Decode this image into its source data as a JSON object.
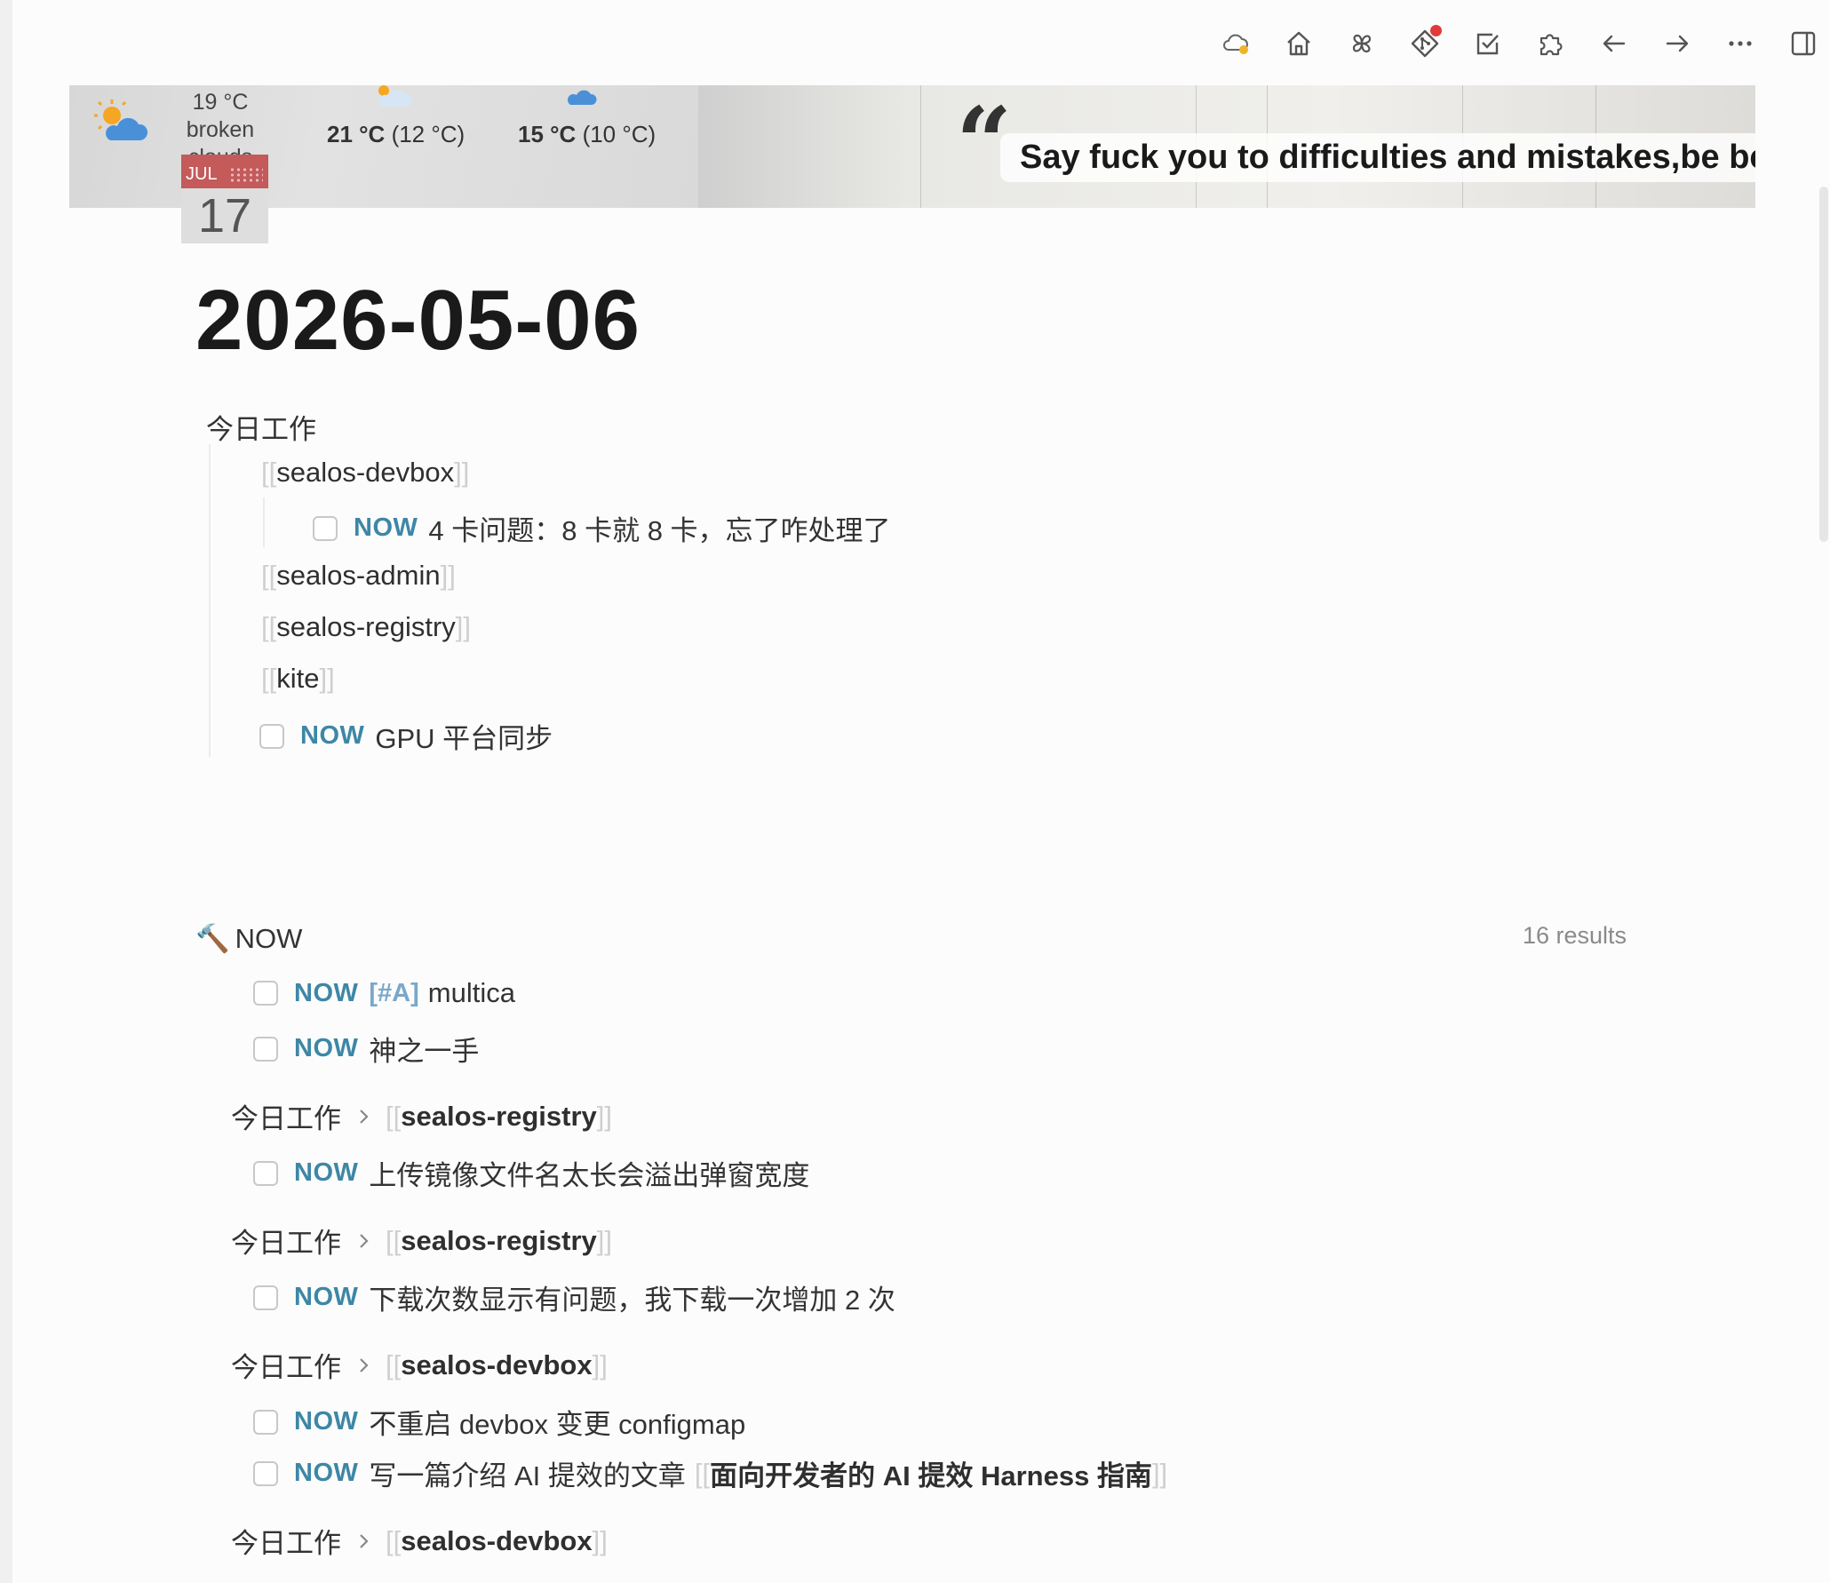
{
  "toolbar": {
    "buttons": [
      {
        "name": "sync-cloud-icon"
      },
      {
        "name": "home-icon"
      },
      {
        "name": "pinwheel-icon"
      },
      {
        "name": "git-icon"
      },
      {
        "name": "todo-check-icon"
      },
      {
        "name": "plugins-puzzle-icon"
      },
      {
        "name": "back-arrow-icon"
      },
      {
        "name": "forward-arrow-icon"
      },
      {
        "name": "more-icon"
      },
      {
        "name": "sidebar-toggle-icon"
      }
    ]
  },
  "weather": {
    "current_temp": "19 °C",
    "current_desc": "broken clouds",
    "forecast": [
      {
        "high": "21 °C",
        "low": "(12 °C)"
      },
      {
        "high": "15 °C",
        "low": "(10 °C)"
      }
    ]
  },
  "calendar": {
    "month": "JUL",
    "day": "17"
  },
  "quote": {
    "text": "Say fuck you to difficulties and mistakes,be better."
  },
  "page": {
    "title": "2026-05-06"
  },
  "outline": {
    "parent": "今日工作",
    "refs": [
      "sealos-devbox",
      "sealos-admin",
      "sealos-registry",
      "kite"
    ],
    "nested_task": {
      "marker": "NOW",
      "text": "4 卡问题：8 卡就 8 卡，忘了咋处理了"
    },
    "task": {
      "marker": "NOW",
      "text": "GPU 平台同步"
    }
  },
  "query": {
    "icon": "🔨",
    "title": "NOW",
    "results": "16 results",
    "items": [
      {
        "marker": "NOW",
        "priority": "[#A]",
        "text": "multica"
      },
      {
        "marker": "NOW",
        "text": "神之一手"
      }
    ],
    "groups": [
      {
        "crumb": "今日工作",
        "ref": "sealos-registry",
        "tasks": [
          {
            "marker": "NOW",
            "text": "上传镜像文件名太长会溢出弹窗宽度"
          }
        ]
      },
      {
        "crumb": "今日工作",
        "ref": "sealos-registry",
        "tasks": [
          {
            "marker": "NOW",
            "text": "下载次数显示有问题，我下载一次增加 2 次"
          }
        ]
      },
      {
        "crumb": "今日工作",
        "ref": "sealos-devbox",
        "tasks": [
          {
            "marker": "NOW",
            "text": "不重启 devbox 变更 configmap"
          },
          {
            "marker": "NOW",
            "text": "写一篇介绍 AI 提效的文章",
            "ref": "面向开发者的 AI 提效 Harness 指南"
          }
        ]
      },
      {
        "crumb": "今日工作",
        "ref": "sealos-devbox"
      }
    ]
  }
}
